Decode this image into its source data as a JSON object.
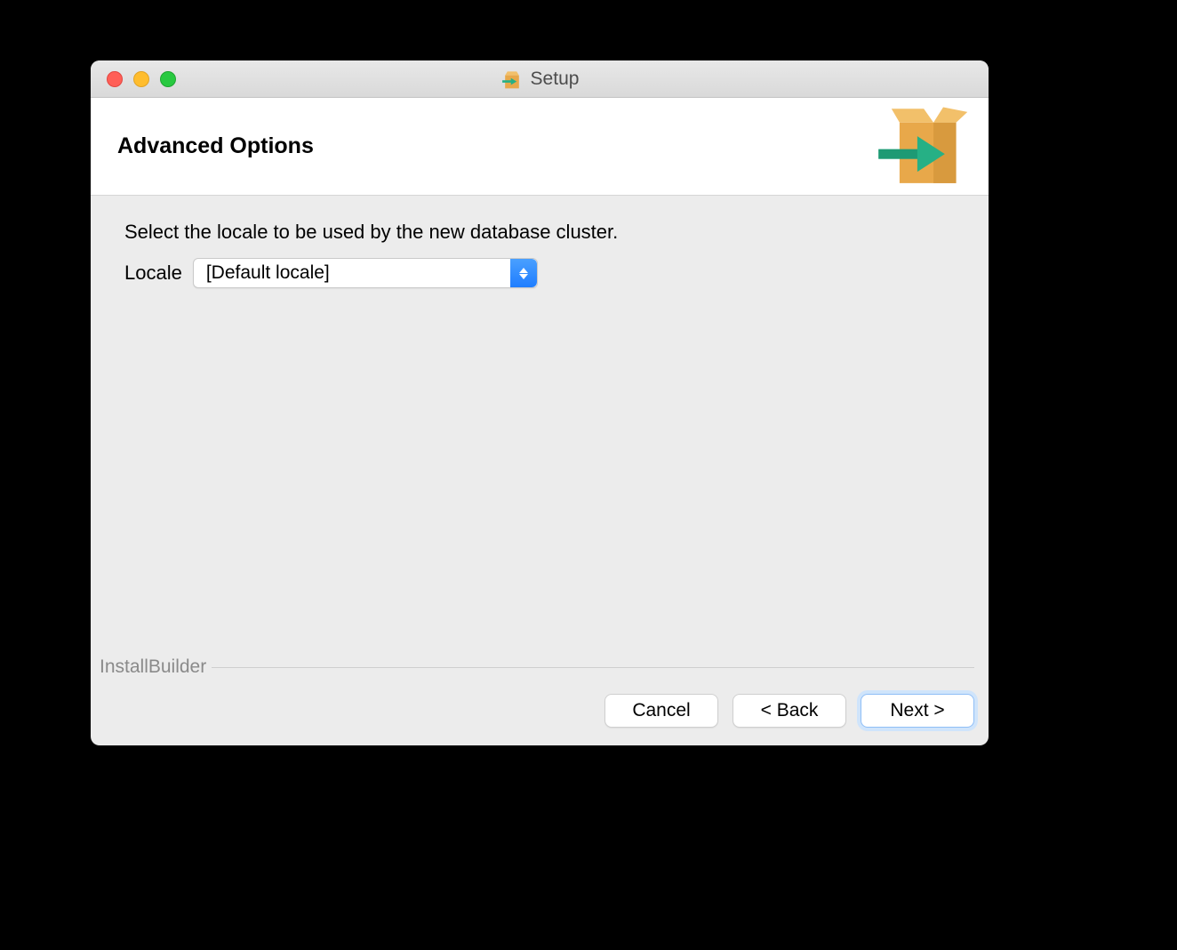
{
  "titlebar": {
    "title": "Setup"
  },
  "header": {
    "title": "Advanced Options"
  },
  "body": {
    "instruction": "Select the locale to be used by the new database cluster.",
    "locale_label": "Locale",
    "locale_value": "[Default locale]"
  },
  "footer": {
    "brand": "InstallBuilder",
    "cancel": "Cancel",
    "back": "< Back",
    "next": "Next >"
  },
  "colors": {
    "accent": "#1f7dff",
    "box_orange": "#e8a84a",
    "arrow_green": "#26b085"
  }
}
